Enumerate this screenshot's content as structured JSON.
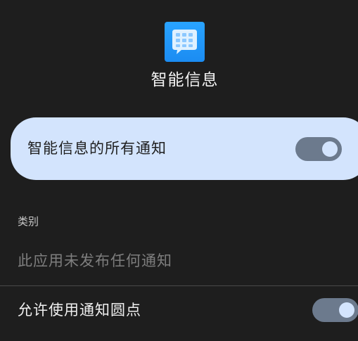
{
  "app": {
    "name": "智能信息",
    "icon": "chat-grid-icon",
    "icon_color": "#1b8cf2"
  },
  "master": {
    "label": "智能信息的所有通知",
    "enabled": true,
    "card_color": "#d3e4fd"
  },
  "categories": {
    "header": "类别",
    "empty_message": "此应用未发布任何通知"
  },
  "badge": {
    "label": "允许使用通知圆点",
    "enabled": true
  },
  "theme": {
    "background": "#1e1e1e",
    "toggle_track": "#6c7a8d"
  }
}
